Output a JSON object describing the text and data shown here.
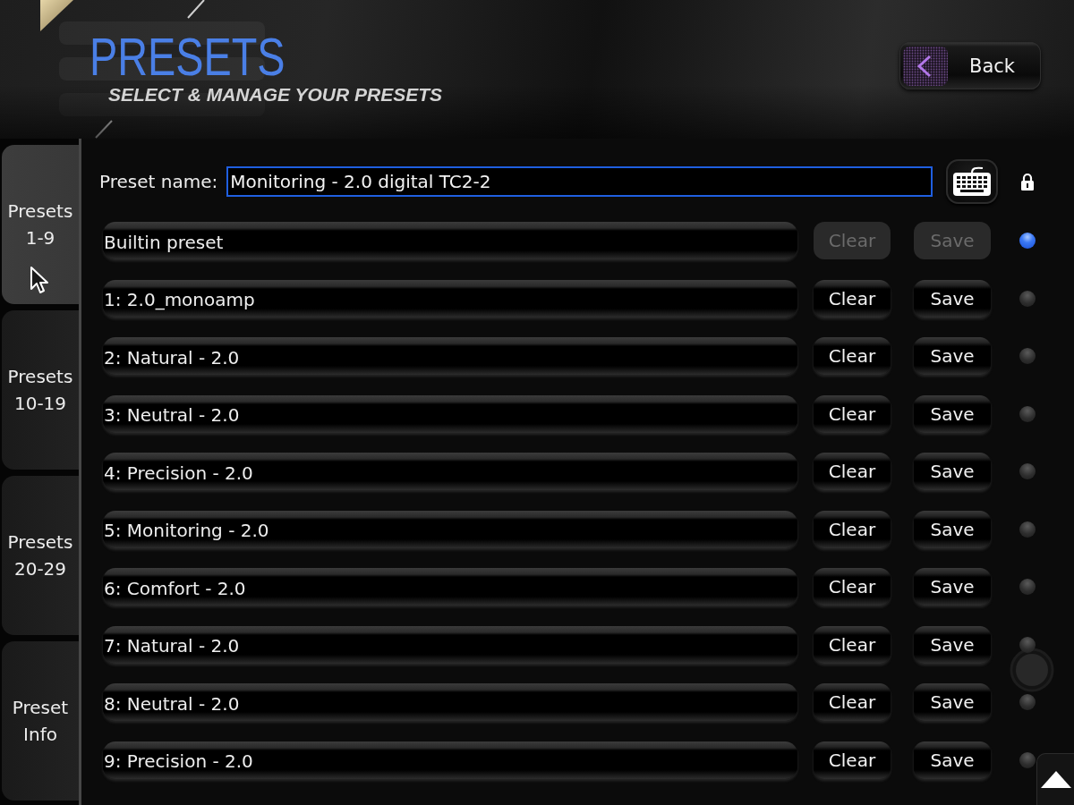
{
  "header": {
    "title": "PRESETS",
    "subtitle": "SELECT & MANAGE YOUR PRESETS",
    "back_button": "Back"
  },
  "sidebar": {
    "tabs": [
      {
        "label": "Presets 1-9",
        "selected": true
      },
      {
        "label": "Presets 10-19",
        "selected": false
      },
      {
        "label": "Presets 20-29",
        "selected": false
      },
      {
        "label": "Preset Info",
        "selected": false
      }
    ]
  },
  "preset_name": {
    "label": "Preset name:",
    "value": "Monitoring - 2.0 digital TC2-2"
  },
  "presets": [
    {
      "name": "Builtin preset",
      "clear": "Clear",
      "save": "Save",
      "disabled": true,
      "selected": true
    },
    {
      "name": "1: 2.0_monoamp",
      "clear": "Clear",
      "save": "Save",
      "disabled": false,
      "selected": false
    },
    {
      "name": "2: Natural - 2.0",
      "clear": "Clear",
      "save": "Save",
      "disabled": false,
      "selected": false
    },
    {
      "name": "3: Neutral - 2.0",
      "clear": "Clear",
      "save": "Save",
      "disabled": false,
      "selected": false
    },
    {
      "name": "4: Precision - 2.0",
      "clear": "Clear",
      "save": "Save",
      "disabled": false,
      "selected": false
    },
    {
      "name": "5: Monitoring - 2.0",
      "clear": "Clear",
      "save": "Save",
      "disabled": false,
      "selected": false
    },
    {
      "name": "6: Comfort - 2.0",
      "clear": "Clear",
      "save": "Save",
      "disabled": false,
      "selected": false
    },
    {
      "name": "7: Natural - 2.0",
      "clear": "Clear",
      "save": "Save",
      "disabled": false,
      "selected": false
    },
    {
      "name": "8: Neutral - 2.0",
      "clear": "Clear",
      "save": "Save",
      "disabled": false,
      "selected": false
    },
    {
      "name": "9: Precision - 2.0",
      "clear": "Clear",
      "save": "Save",
      "disabled": false,
      "selected": false
    }
  ]
}
